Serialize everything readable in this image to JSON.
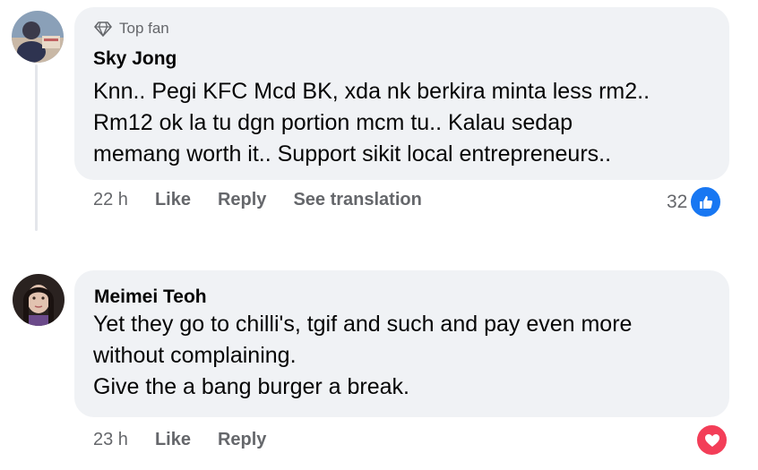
{
  "colors": {
    "bubble": "#f0f2f5",
    "secondary_text": "#65676b",
    "like_blue": "#1877f2",
    "love_red": "#f33e58"
  },
  "comments": [
    {
      "badge": "Top fan",
      "badge_icon": "diamond-icon",
      "author": "Sky Jong",
      "lines": [
        "Knn.. Pegi KFC Mcd BK, xda nk berkira minta less rm2..",
        "Rm12 ok la tu dgn portion mcm tu.. Kalau sedap",
        "memang worth it.. Support sikit local entrepreneurs.."
      ],
      "time": "22 h",
      "like": "Like",
      "reply": "Reply",
      "translate": "See translation",
      "reaction_count": "32",
      "reaction_icon": "like-thumb-icon"
    },
    {
      "author": "Meimei Teoh",
      "lines": [
        "Yet they go to chilli's, tgif and such and pay even more",
        "without complaining.",
        "Give the a bang burger a break."
      ],
      "time": "23 h",
      "like": "Like",
      "reply": "Reply",
      "reaction_icon": "love-heart-icon"
    }
  ]
}
